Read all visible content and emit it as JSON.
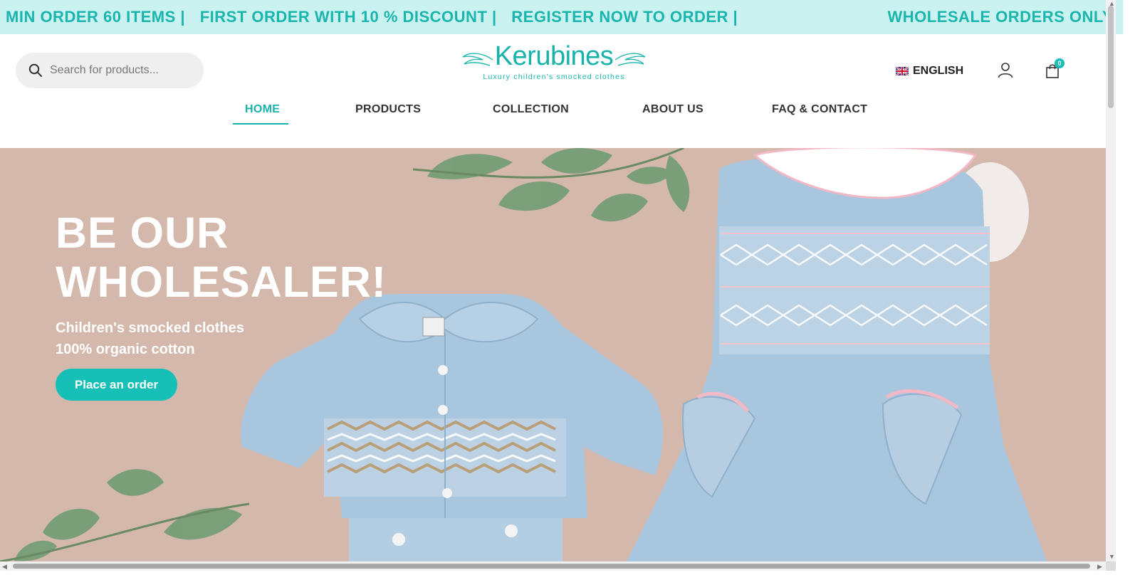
{
  "announcement": {
    "items": [
      "MIN ORDER 60 ITEMS |",
      "FIRST ORDER WITH 10 % DISCOUNT |",
      "REGISTER NOW TO ORDER |"
    ],
    "right": "WHOLESALE ORDERS ONLY"
  },
  "search": {
    "placeholder": "Search for products..."
  },
  "logo": {
    "name": "Kerubines",
    "tagline": "Luxury children's smocked clothes"
  },
  "language": {
    "label": "ENGLISH",
    "flag": "uk-flag-icon"
  },
  "cart": {
    "count": "0"
  },
  "nav": [
    "HOME",
    "PRODUCTS",
    "COLLECTION",
    "ABOUT US",
    "FAQ & CONTACT"
  ],
  "hero": {
    "title_line1": "BE OUR",
    "title_line2": "WHOLESALER!",
    "sub_line1": "Children's smocked clothes",
    "sub_line2": "100% organic cotton",
    "cta": "Place an order"
  },
  "colors": {
    "accent": "#17b3ab",
    "announce_bg": "#c9f2f0",
    "hero_bg": "#d4b8ab",
    "garment": "#a9c6df"
  }
}
